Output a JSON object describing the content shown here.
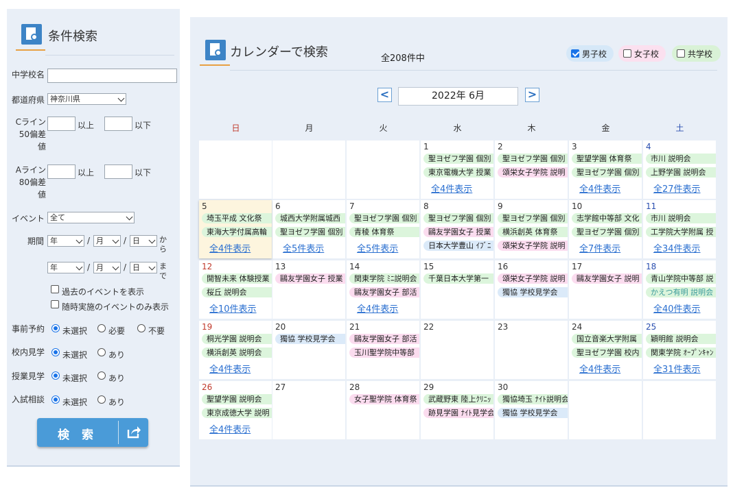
{
  "left": {
    "title": "条件検索",
    "school_name_label": "中学校名",
    "pref_label": "都道府県",
    "pref_value": "神奈川県",
    "cline_label": "Cライン 50偏差値",
    "aline_label": "Aライン 80偏差値",
    "above": "以上",
    "below": "以下",
    "event_label": "イベント",
    "event_value": "全て",
    "period_label": "期間",
    "year": "年",
    "month": "月",
    "day": "日",
    "slash": "/",
    "from": "から",
    "to": "まで",
    "past_events": "過去のイベントを表示",
    "anytime_only": "随時実施のイベントのみ表示",
    "reservation_label": "事前予約",
    "school_visit_label": "校内見学",
    "class_visit_label": "授業見学",
    "exam_consult_label": "入試相談",
    "opt_unselected": "未選択",
    "opt_required": "必要",
    "opt_not_required": "不要",
    "opt_yes": "あり",
    "search_button": "検 索"
  },
  "right": {
    "title": "カレンダーで検索",
    "count": "全208件中",
    "filters": [
      {
        "label": "男子校",
        "checked": true
      },
      {
        "label": "女子校",
        "checked": false
      },
      {
        "label": "共学校",
        "checked": false
      }
    ],
    "prev": "<",
    "next": ">",
    "month": "2022年 6月",
    "weekdays": [
      "日",
      "月",
      "火",
      "水",
      "木",
      "金",
      "土"
    ]
  },
  "calendar": {
    "weeks": [
      [
        null,
        null,
        null,
        {
          "day": "1",
          "events": [
            {
              "t": "聖ヨゼフ学園 個別",
              "c": "g"
            },
            {
              "t": "東京電機大学 授業",
              "c": "g"
            }
          ],
          "more": "全4件表示"
        },
        {
          "day": "2",
          "events": [
            {
              "t": "聖ヨゼフ学園 個別",
              "c": "g"
            },
            {
              "t": "頌栄女子学院 説明",
              "c": "p"
            }
          ],
          "more": null
        },
        {
          "day": "3",
          "events": [
            {
              "t": "聖望学園 体育祭",
              "c": "g"
            },
            {
              "t": "聖ヨゼフ学園 個別",
              "c": "g"
            }
          ],
          "more": "全4件表示"
        },
        {
          "day": "4",
          "events": [
            {
              "t": "市川 説明会",
              "c": "g"
            },
            {
              "t": "上野学園 説明会",
              "c": "g"
            }
          ],
          "more": "全27件表示"
        }
      ],
      [
        {
          "day": "5",
          "today": true,
          "events": [
            {
              "t": "埼玉平成 文化祭",
              "c": "g"
            },
            {
              "t": "東海大学付属高輪",
              "c": "g"
            }
          ],
          "more": "全4件表示"
        },
        {
          "day": "6",
          "events": [
            {
              "t": "城西大学附属城西",
              "c": "g"
            },
            {
              "t": "聖ヨゼフ学園 個別",
              "c": "g"
            }
          ],
          "more": "全5件表示"
        },
        {
          "day": "7",
          "events": [
            {
              "t": "聖ヨゼフ学園 個別",
              "c": "g"
            },
            {
              "t": "青稜 体育祭",
              "c": "g"
            }
          ],
          "more": "全5件表示"
        },
        {
          "day": "8",
          "events": [
            {
              "t": "聖ヨゼフ学園 個別",
              "c": "g"
            },
            {
              "t": "鷗友学園女子 授業",
              "c": "p"
            },
            {
              "t": "日本大学豊山 ｲﾌﾞﾆ",
              "c": "b"
            }
          ],
          "more": null
        },
        {
          "day": "9",
          "events": [
            {
              "t": "聖ヨゼフ学園 個別",
              "c": "g"
            },
            {
              "t": "横浜創英 体育祭",
              "c": "g"
            },
            {
              "t": "頌栄女子学院 説明",
              "c": "p"
            }
          ],
          "more": null
        },
        {
          "day": "10",
          "events": [
            {
              "t": "志学館中等部 文化",
              "c": "g"
            },
            {
              "t": "聖ヨゼフ学園 個別",
              "c": "g"
            }
          ],
          "more": "全7件表示"
        },
        {
          "day": "11",
          "events": [
            {
              "t": "市川 説明会",
              "c": "g"
            },
            {
              "t": "工学院大学附属 授",
              "c": "g"
            }
          ],
          "more": "全34件表示"
        }
      ],
      [
        {
          "day": "12",
          "red": true,
          "events": [
            {
              "t": "開智未来 体験授業",
              "c": "g"
            },
            {
              "t": "桜丘 説明会",
              "c": "g"
            }
          ],
          "more": "全10件表示"
        },
        {
          "day": "13",
          "events": [
            {
              "t": "鷗友学園女子 授業",
              "c": "p"
            }
          ],
          "more": null
        },
        {
          "day": "14",
          "events": [
            {
              "t": "関東学院 ﾐﾆ説明会",
              "c": "g"
            },
            {
              "t": "鷗友学園女子 部活",
              "c": "p"
            }
          ],
          "more": "全4件表示"
        },
        {
          "day": "15",
          "events": [
            {
              "t": "千葉日本大学第一",
              "c": "g"
            }
          ],
          "more": null
        },
        {
          "day": "16",
          "events": [
            {
              "t": "頌栄女子学院 説明",
              "c": "p"
            },
            {
              "t": "獨協 学校見学会",
              "c": "b"
            }
          ],
          "more": null
        },
        {
          "day": "17",
          "events": [
            {
              "t": "鷗友学園女子 説明",
              "c": "p"
            }
          ],
          "more": null
        },
        {
          "day": "18",
          "events": [
            {
              "t": "青山学院中等部 説",
              "c": "g"
            },
            {
              "t": "かえつ有明 説明会",
              "c": "gc"
            }
          ],
          "more": "全40件表示"
        }
      ],
      [
        {
          "day": "19",
          "red": true,
          "events": [
            {
              "t": "桐光学園 説明会",
              "c": "g"
            },
            {
              "t": "横浜創英 説明会",
              "c": "g"
            }
          ],
          "more": "全4件表示"
        },
        {
          "day": "20",
          "events": [
            {
              "t": "獨協 学校見学会",
              "c": "b"
            }
          ],
          "more": null
        },
        {
          "day": "21",
          "events": [
            {
              "t": "鷗友学園女子 部活",
              "c": "p"
            },
            {
              "t": "玉川聖学院中等部",
              "c": "p"
            }
          ],
          "more": null
        },
        {
          "day": "22",
          "events": [],
          "more": null
        },
        {
          "day": "23",
          "events": [],
          "more": null
        },
        {
          "day": "24",
          "events": [
            {
              "t": "国立音楽大学附属",
              "c": "g"
            },
            {
              "t": "聖ヨゼフ学園 校内",
              "c": "g"
            }
          ],
          "more": "全4件表示"
        },
        {
          "day": "25",
          "events": [
            {
              "t": "穎明館 説明会",
              "c": "g"
            },
            {
              "t": "関東学院 ｵｰﾌﾟﾝｷｬﾝ",
              "c": "g"
            }
          ],
          "more": "全31件表示"
        }
      ],
      [
        {
          "day": "26",
          "red": true,
          "events": [
            {
              "t": "聖望学園 説明会",
              "c": "g"
            },
            {
              "t": "東京成徳大学 説明",
              "c": "g"
            }
          ],
          "more": "全4件表示"
        },
        {
          "day": "27",
          "events": [],
          "more": null
        },
        {
          "day": "28",
          "events": [
            {
              "t": "女子聖学院 体育祭",
              "c": "p"
            }
          ],
          "more": null
        },
        {
          "day": "29",
          "events": [
            {
              "t": "武蔵野東 陸上ｸﾘﾆｯ",
              "c": "g"
            },
            {
              "t": "跡見学園 ﾅｲﾄ見学会",
              "c": "p"
            }
          ],
          "more": null
        },
        {
          "day": "30",
          "events": [
            {
              "t": "獨協埼玉 ﾅｲﾄ説明会",
              "c": "g"
            },
            {
              "t": "獨協 学校見学会",
              "c": "b"
            }
          ],
          "more": null
        },
        null,
        null
      ]
    ]
  }
}
